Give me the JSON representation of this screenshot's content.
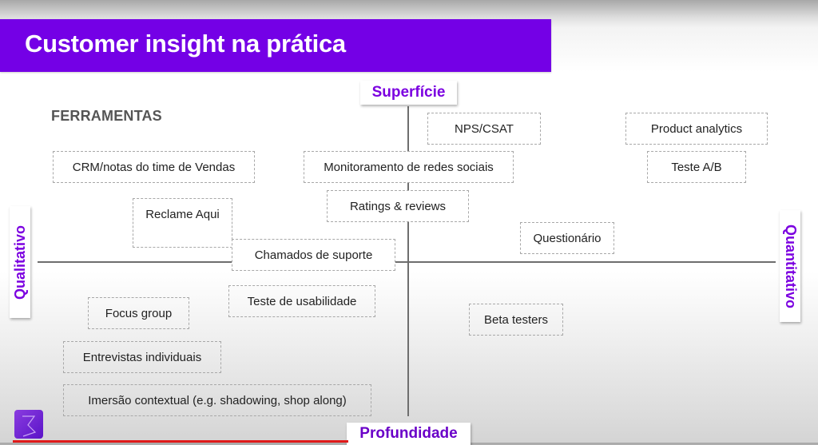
{
  "slide": {
    "title": "Customer insight na prática",
    "section_label": "FERRAMENTAS",
    "colors": {
      "brand_purple": "#7400e6",
      "axis_label_text": "#7b00e0",
      "box_border": "#a8a8a8",
      "progress_line": "#e01a1a"
    },
    "axes": {
      "top": "Superfície",
      "bottom": "Profundidade",
      "left": "Qualitativo",
      "right": "Quantitativo"
    },
    "tools": [
      {
        "label": "NPS/CSAT",
        "quadrant": "top-right"
      },
      {
        "label": "Product analytics",
        "quadrant": "top-right"
      },
      {
        "label": "CRM/notas do time de Vendas",
        "quadrant": "top-left"
      },
      {
        "label": "Monitoramento de redes sociais",
        "quadrant": "top-center"
      },
      {
        "label": "Teste A/B",
        "quadrant": "top-right"
      },
      {
        "label": "Ratings & reviews",
        "quadrant": "top-center"
      },
      {
        "label": "Reclame Aqui",
        "quadrant": "top-left"
      },
      {
        "label": "Questionário",
        "quadrant": "top-right"
      },
      {
        "label": "Chamados de suporte",
        "quadrant": "center-left"
      },
      {
        "label": "Teste de usabilidade",
        "quadrant": "bottom-left"
      },
      {
        "label": "Focus group",
        "quadrant": "bottom-left"
      },
      {
        "label": "Beta testers",
        "quadrant": "bottom-right"
      },
      {
        "label": "Entrevistas individuais",
        "quadrant": "bottom-left"
      },
      {
        "label": "Imersão contextual (e.g. shadowing, shop along)",
        "quadrant": "bottom-left"
      }
    ],
    "logo_icon": "brand-logo-icon"
  }
}
